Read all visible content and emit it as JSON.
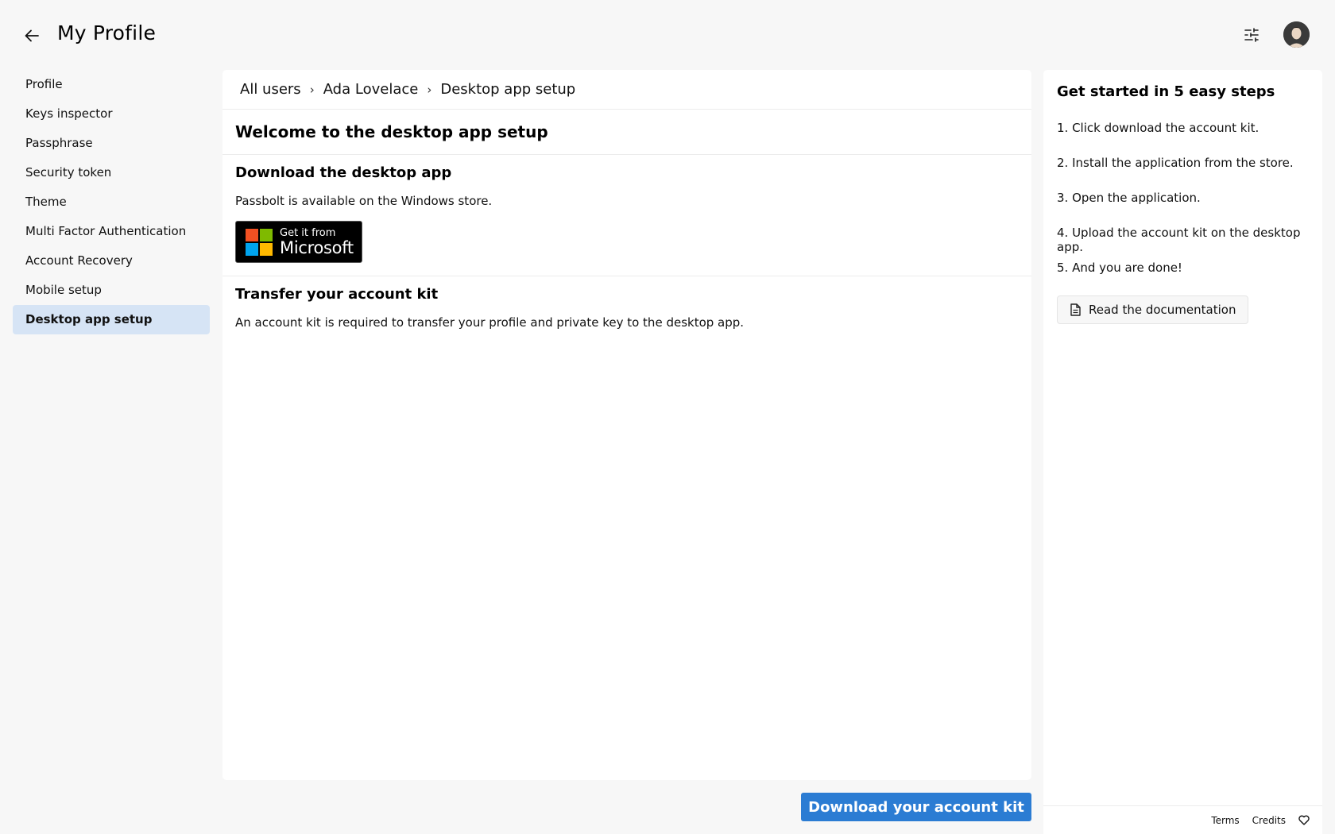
{
  "header": {
    "title": "My Profile",
    "back_icon": "arrow-left-icon",
    "filter_icon": "sliders-icon"
  },
  "sidebar": {
    "items": [
      {
        "label": "Profile"
      },
      {
        "label": "Keys inspector"
      },
      {
        "label": "Passphrase"
      },
      {
        "label": "Security token"
      },
      {
        "label": "Theme"
      },
      {
        "label": "Multi Factor Authentication"
      },
      {
        "label": "Account Recovery"
      },
      {
        "label": "Mobile setup"
      },
      {
        "label": "Desktop app setup",
        "active": true
      }
    ]
  },
  "breadcrumb": {
    "items": [
      "All users",
      "Ada Lovelace",
      "Desktop app setup"
    ],
    "separator": "›"
  },
  "main": {
    "title": "Welcome to the desktop app setup",
    "download": {
      "heading": "Download the desktop app",
      "text": "Passbolt is available on the Windows store.",
      "badge_small": "Get it from",
      "badge_big": "Microsoft"
    },
    "transfer": {
      "heading": "Transfer your account kit",
      "text": "An account kit is required to transfer your profile and private key to the desktop app."
    },
    "primary_button": "Download your account kit"
  },
  "help": {
    "title": "Get started in 5 easy steps",
    "steps": [
      "1. Click download the account kit.",
      "2. Install the application from the store.",
      "3. Open the application.",
      "4. Upload the account kit on the desktop app.",
      "5. And you are done!"
    ],
    "doc_button": "Read the documentation"
  },
  "footer": {
    "terms": "Terms",
    "credits": "Credits"
  },
  "colors": {
    "accent": "#2b7cd3",
    "active_bg": "#d6e4f5",
    "ms_red": "#f25022",
    "ms_green": "#7fba00",
    "ms_blue": "#00a4ef",
    "ms_yellow": "#ffb900"
  }
}
